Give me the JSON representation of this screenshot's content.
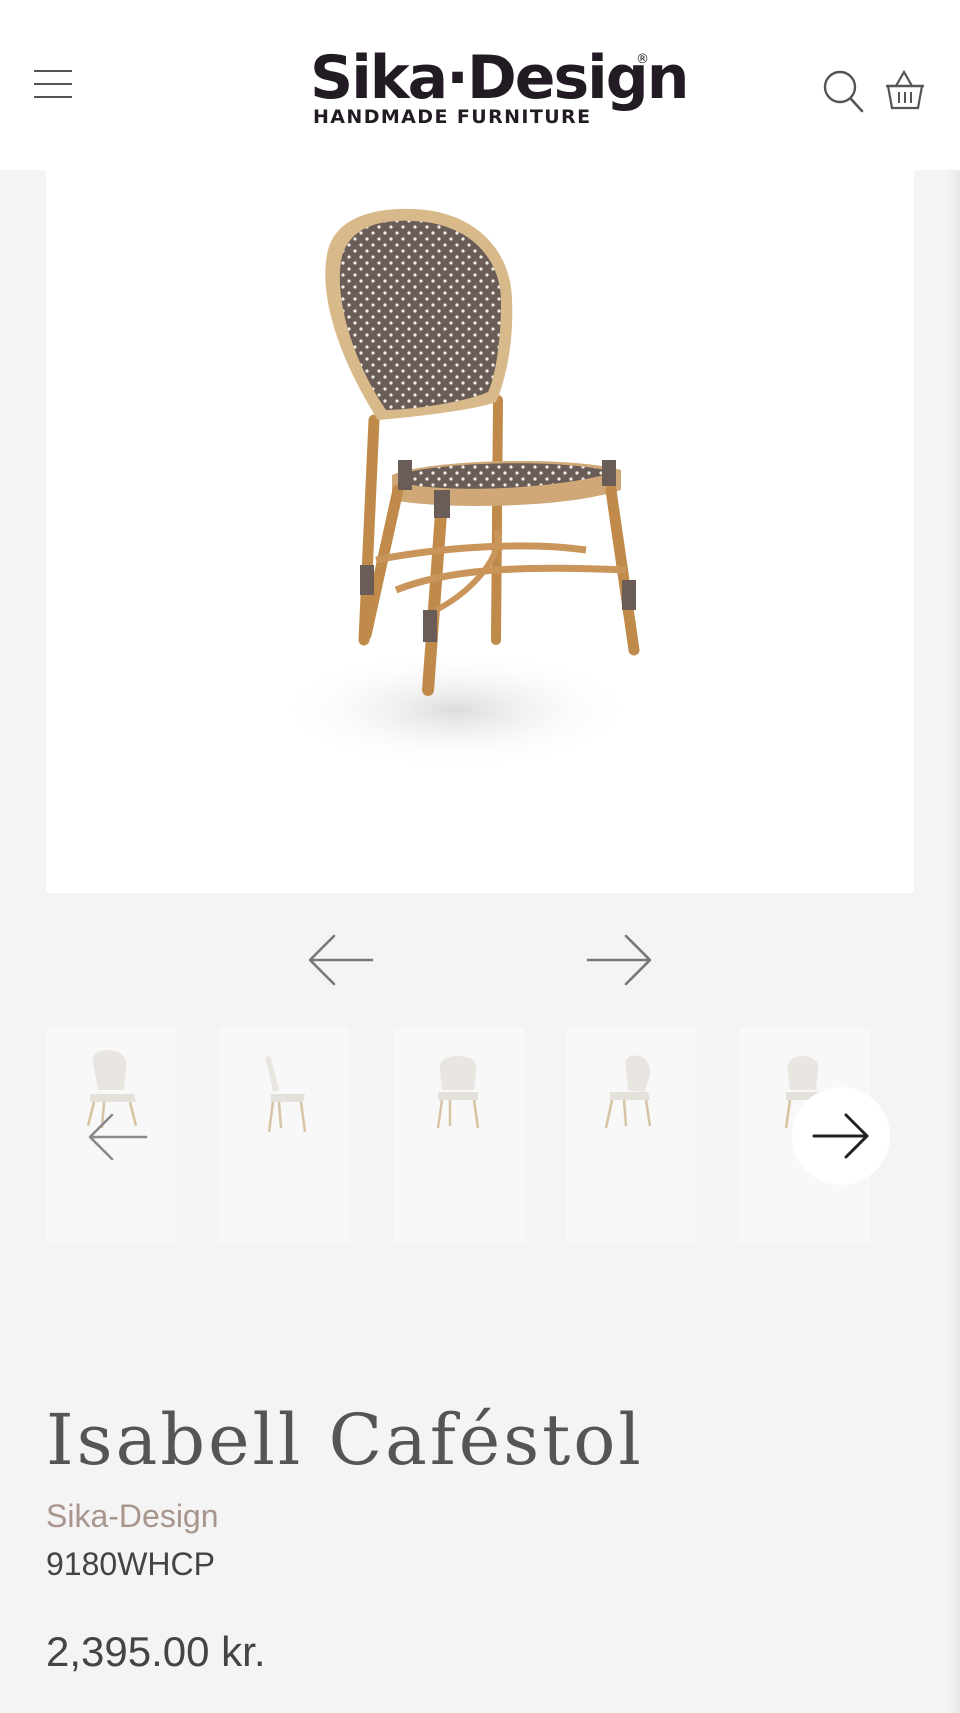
{
  "header": {
    "logo_text": "Sika·Design",
    "logo_registered": "®",
    "logo_tagline": "HANDMADE FURNITURE",
    "menu_icon": "hamburger-menu-icon",
    "search_icon": "search-icon",
    "cart_icon": "basket-icon"
  },
  "gallery": {
    "main_image": "rattan-chair-cappuccino-weave",
    "prev_icon": "arrow-left-icon",
    "next_icon": "arrow-right-icon",
    "thumbnails": [
      {
        "image": "white-chair-front"
      },
      {
        "image": "white-chair-side"
      },
      {
        "image": "white-chair-back"
      },
      {
        "image": "white-chair-angle"
      },
      {
        "image": "white-chair-front-2"
      }
    ]
  },
  "product": {
    "title": "Isabell Caféstol",
    "brand": "Sika-Design",
    "sku": "9180WHCP",
    "price": "2,395.00 kr."
  },
  "colors": {
    "background": "#f4f4f4",
    "header": "#ffffff",
    "logo": "#231b24",
    "brand_link": "#a8958c",
    "text": "#444444"
  }
}
